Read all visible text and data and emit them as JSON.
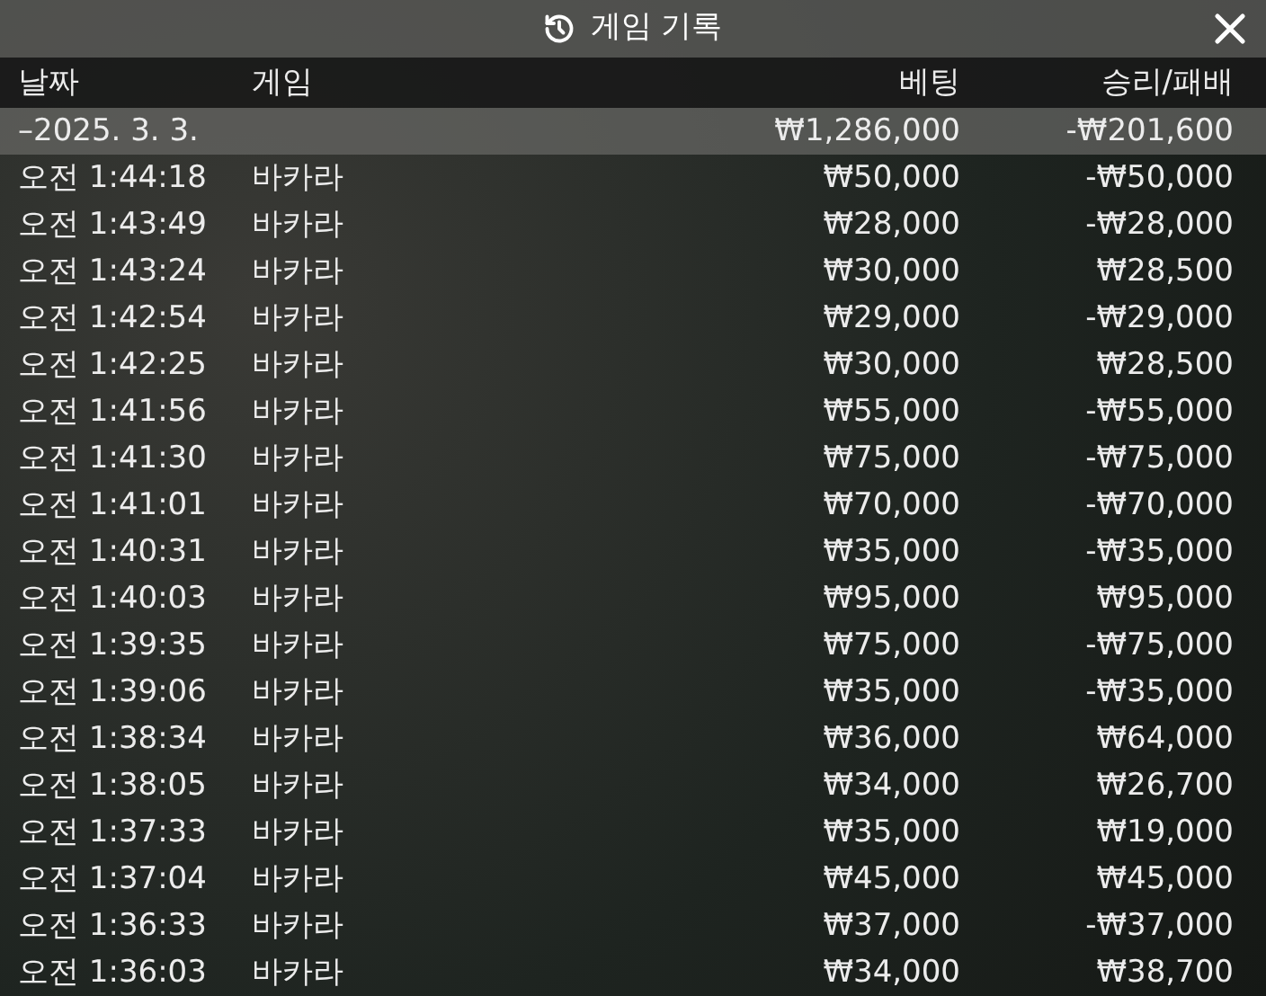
{
  "window": {
    "title": "게임 기록"
  },
  "table": {
    "columns": [
      "날짜",
      "게임",
      "베팅",
      "승리/패배"
    ],
    "group": {
      "date": "–2025. 3. 3.",
      "bet": "₩1,286,000",
      "result": "-₩201,600"
    },
    "rows": [
      {
        "time": "오전 1:44:18",
        "game": "바카라",
        "bet": "₩50,000",
        "result": "-₩50,000"
      },
      {
        "time": "오전 1:43:49",
        "game": "바카라",
        "bet": "₩28,000",
        "result": "-₩28,000"
      },
      {
        "time": "오전 1:43:24",
        "game": "바카라",
        "bet": "₩30,000",
        "result": "₩28,500"
      },
      {
        "time": "오전 1:42:54",
        "game": "바카라",
        "bet": "₩29,000",
        "result": "-₩29,000"
      },
      {
        "time": "오전 1:42:25",
        "game": "바카라",
        "bet": "₩30,000",
        "result": "₩28,500"
      },
      {
        "time": "오전 1:41:56",
        "game": "바카라",
        "bet": "₩55,000",
        "result": "-₩55,000"
      },
      {
        "time": "오전 1:41:30",
        "game": "바카라",
        "bet": "₩75,000",
        "result": "-₩75,000"
      },
      {
        "time": "오전 1:41:01",
        "game": "바카라",
        "bet": "₩70,000",
        "result": "-₩70,000"
      },
      {
        "time": "오전 1:40:31",
        "game": "바카라",
        "bet": "₩35,000",
        "result": "-₩35,000"
      },
      {
        "time": "오전 1:40:03",
        "game": "바카라",
        "bet": "₩95,000",
        "result": "₩95,000"
      },
      {
        "time": "오전 1:39:35",
        "game": "바카라",
        "bet": "₩75,000",
        "result": "-₩75,000"
      },
      {
        "time": "오전 1:39:06",
        "game": "바카라",
        "bet": "₩35,000",
        "result": "-₩35,000"
      },
      {
        "time": "오전 1:38:34",
        "game": "바카라",
        "bet": "₩36,000",
        "result": "₩64,000"
      },
      {
        "time": "오전 1:38:05",
        "game": "바카라",
        "bet": "₩34,000",
        "result": "₩26,700"
      },
      {
        "time": "오전 1:37:33",
        "game": "바카라",
        "bet": "₩35,000",
        "result": "₩19,000"
      },
      {
        "time": "오전 1:37:04",
        "game": "바카라",
        "bet": "₩45,000",
        "result": "₩45,000"
      },
      {
        "time": "오전 1:36:33",
        "game": "바카라",
        "bet": "₩37,000",
        "result": "-₩37,000"
      },
      {
        "time": "오전 1:36:03",
        "game": "바카라",
        "bet": "₩34,000",
        "result": "₩38,700"
      }
    ]
  }
}
